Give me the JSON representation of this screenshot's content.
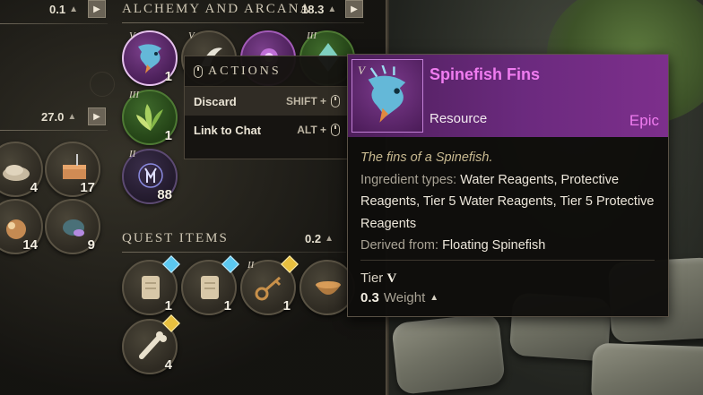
{
  "sections": {
    "left_top_weight": "0.1",
    "left_mid_weight": "27.0",
    "alchemy": {
      "title": "ALCHEMY AND ARCANA",
      "weight": "18.3"
    },
    "quest": {
      "title": "QUEST ITEMS",
      "weight": "0.2"
    }
  },
  "left_items": [
    {
      "count": "4"
    },
    {
      "count": "17"
    },
    {
      "count": "14"
    },
    {
      "count": "9"
    }
  ],
  "alchemy_items": [
    {
      "tier": "V",
      "count": "1",
      "rarity": "epic"
    },
    {
      "tier": "V",
      "count": "",
      "rarity": "common"
    },
    {
      "tier": "",
      "count": "",
      "rarity": "epic"
    },
    {
      "tier": "III",
      "count": "",
      "rarity": "green"
    },
    {
      "tier": "III",
      "count": "1",
      "rarity": "green"
    },
    {
      "tier": "II",
      "count": "88",
      "rarity": "purple-dark"
    }
  ],
  "quest_items": [
    {
      "count": "1",
      "marker": "blue"
    },
    {
      "count": "1",
      "marker": "blue"
    },
    {
      "tier": "II",
      "count": "1",
      "marker": "gold"
    },
    {
      "count": "",
      "marker": ""
    },
    {
      "count": "4",
      "marker": "gold"
    }
  ],
  "actions_menu": {
    "title": "ACTIONS",
    "items": [
      {
        "label": "Discard",
        "shortcut": "SHIFT +"
      },
      {
        "label": "Link to Chat",
        "shortcut": "ALT +"
      }
    ]
  },
  "tooltip": {
    "tier_mark": "V",
    "name": "Spinefish Fins",
    "type": "Resource",
    "rarity": "Epic",
    "description": "The fins of a Spinefish.",
    "ingredient_label": "Ingredient types:",
    "ingredient_value": "Water Reagents, Protective Reagents, Tier 5 Water Reagents, Tier 5 Protective Reagents",
    "derived_label": "Derived from:",
    "derived_value": "Floating Spinefish",
    "tier_label": "Tier",
    "tier_value": "V",
    "weight_value": "0.3",
    "weight_label": "Weight"
  },
  "colors": {
    "epic": "#f07cf0",
    "header_bg": "#6b2a7e",
    "quest_blue": "#5cc8f0",
    "quest_gold": "#e8c040"
  }
}
